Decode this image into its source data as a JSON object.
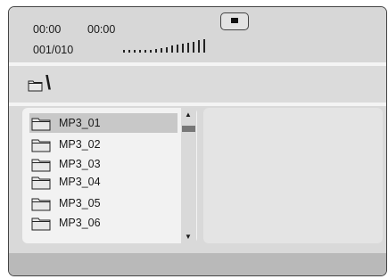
{
  "status": {
    "time_elapsed": "00:00",
    "time_total": "00:00",
    "track_counter": "001/010",
    "volume_level": 0.6
  },
  "path": {
    "current": "\\"
  },
  "file_list": [
    {
      "label": "MP3_01",
      "selected": true
    },
    {
      "label": "MP3_02",
      "selected": false
    },
    {
      "label": "MP3_03",
      "selected": false
    },
    {
      "label": "MP3_04",
      "selected": false
    },
    {
      "label": "MP3_05",
      "selected": false
    },
    {
      "label": "MP3_06",
      "selected": false
    }
  ],
  "scrollbar": {
    "up_glyph": "▲",
    "down_glyph": "▼"
  },
  "icons": {
    "folder": "folder-icon",
    "stop": "stop-icon",
    "volume": "volume-bars-icon"
  }
}
